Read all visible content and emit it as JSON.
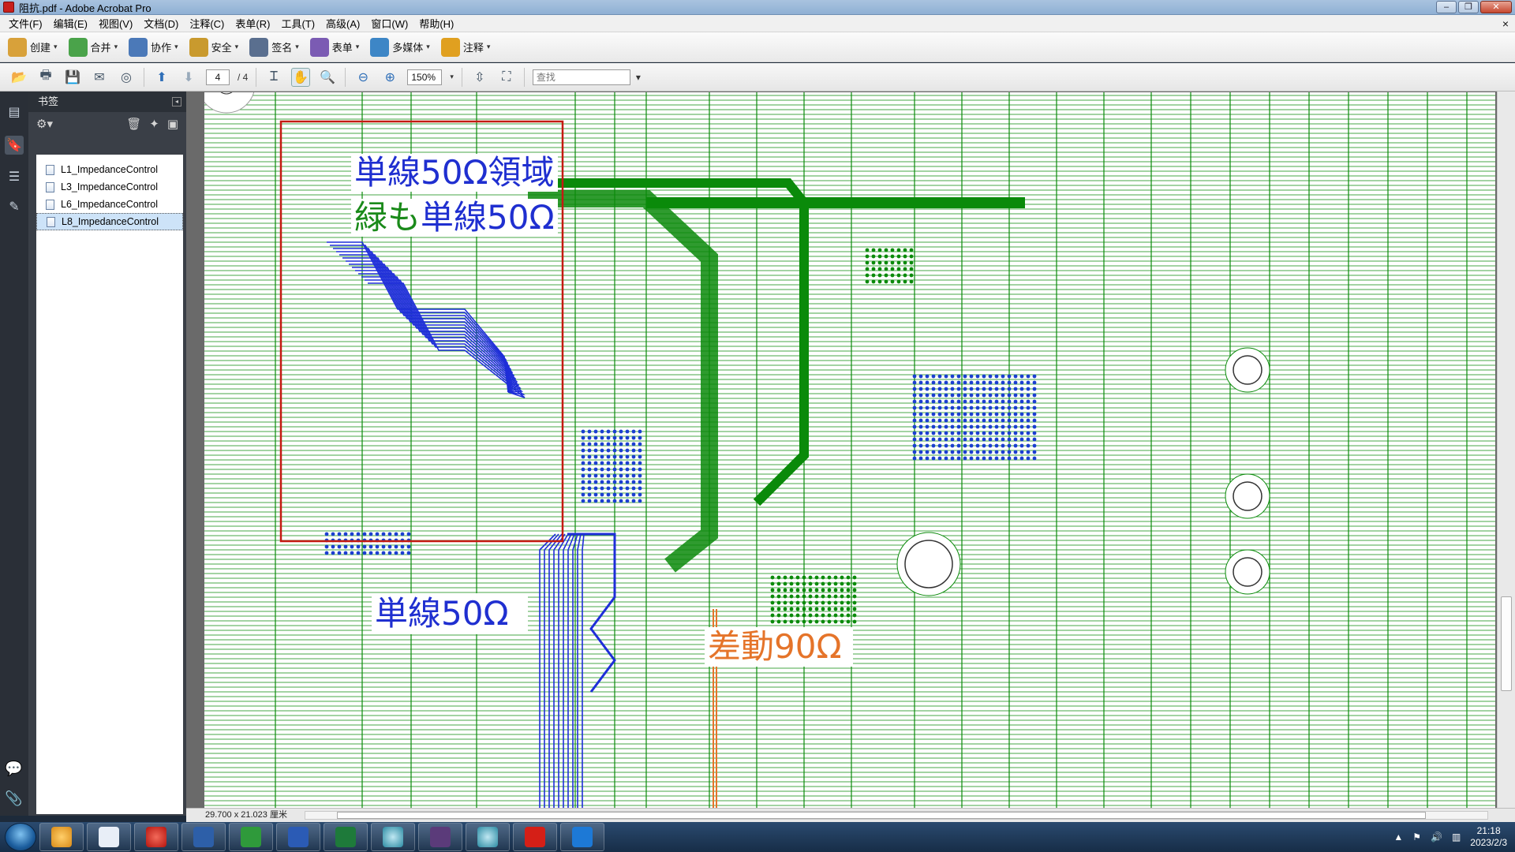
{
  "window": {
    "title": "阻抗.pdf - Adobe Acrobat Pro"
  },
  "menu": [
    "文件(F)",
    "编辑(E)",
    "视图(V)",
    "文档(D)",
    "注释(C)",
    "表单(R)",
    "工具(T)",
    "高级(A)",
    "窗口(W)",
    "帮助(H)"
  ],
  "tasks": [
    {
      "label": "创建",
      "color": "#d8a13a"
    },
    {
      "label": "合并",
      "color": "#4aa34a"
    },
    {
      "label": "协作",
      "color": "#4b79b8"
    },
    {
      "label": "安全",
      "color": "#c99a2e"
    },
    {
      "label": "签名",
      "color": "#5a6f8f"
    },
    {
      "label": "表单",
      "color": "#7b5bb3"
    },
    {
      "label": "多媒体",
      "color": "#3d86c6"
    },
    {
      "label": "注释",
      "color": "#e0a020"
    }
  ],
  "toolbar": {
    "current_page": "4",
    "page_total": "/ 4",
    "zoom": "150%",
    "find_placeholder": "查找"
  },
  "bookmarks": {
    "header": "书签",
    "items": [
      "L1_ImpedanceControl",
      "L3_ImpedanceControl",
      "L6_ImpedanceControl",
      "L8_ImpedanceControl"
    ],
    "selected_index": 3
  },
  "statusbar": {
    "page_size": "29.700 x 21.023 厘米"
  },
  "annotations": [
    {
      "text": "単線50Ω領域",
      "color": "#1f2fd0"
    },
    {
      "text": "緑も単線50Ω",
      "color": "#1a8a1a",
      "text2": "単線50Ω",
      "color2": "#1f2fd0"
    },
    {
      "text": "単線50Ω",
      "color": "#1f2fd0"
    },
    {
      "text": "差動90Ω",
      "color": "#e5742a"
    }
  ],
  "clock": {
    "time": "21:18",
    "date": "2023/2/3"
  },
  "colors": {
    "trace_green": "#0a8a0a",
    "trace_blue": "#1e2ed8",
    "highlight_red": "#c41a12",
    "diff_orange": "#e5742a"
  }
}
